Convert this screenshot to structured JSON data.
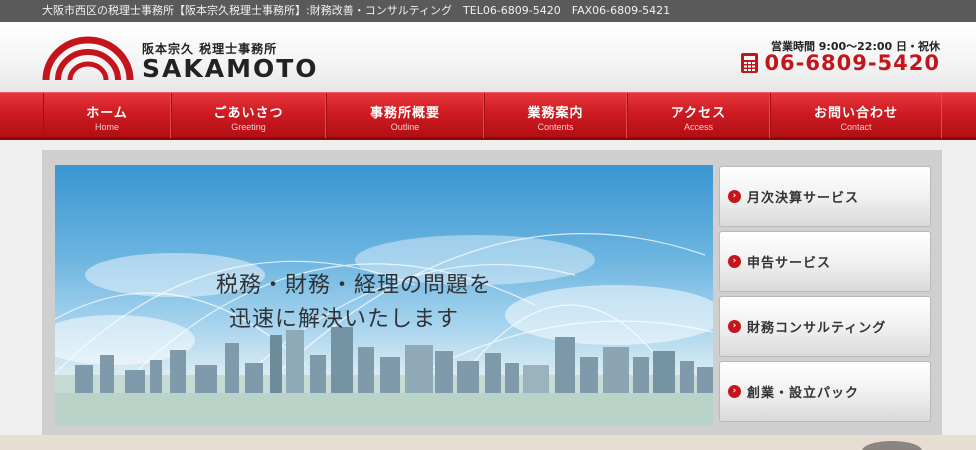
{
  "topbar": {
    "text": "大阪市西区の税理士事務所【阪本宗久税理士事務所】:財務改善・コンサルティング　TEL06-6809-5420　FAX06-6809-5421"
  },
  "brand": {
    "subtitle": "阪本宗久 税理士事務所",
    "name": "SAKAMOTO"
  },
  "contact": {
    "hours": "営業時間 9:00～22:00 日・祝休",
    "phone": "06-6809-5420"
  },
  "nav": {
    "items": [
      {
        "label": "ホーム",
        "sub": "Home"
      },
      {
        "label": "ごあいさつ",
        "sub": "Greeting"
      },
      {
        "label": "事務所概要",
        "sub": "Outline"
      },
      {
        "label": "業務案内",
        "sub": "Contents"
      },
      {
        "label": "アクセス",
        "sub": "Access"
      },
      {
        "label": "お問い合わせ",
        "sub": "Contact"
      }
    ]
  },
  "hero": {
    "line1": "税務・財務・経理の問題を",
    "line2": "迅速に解決いたします"
  },
  "services": [
    {
      "label": "月次決算サービス"
    },
    {
      "label": "申告サービス"
    },
    {
      "label": "財務コンサルティング"
    },
    {
      "label": "創業・設立パック"
    }
  ],
  "colors": {
    "brand_red": "#c4151c",
    "nav_red": "#cf1b22",
    "topbar": "#5a5a5a"
  },
  "icons": {
    "phone": "phone-icon",
    "arrow": "arrow-right-icon",
    "logo": "logo-arcs-icon"
  }
}
